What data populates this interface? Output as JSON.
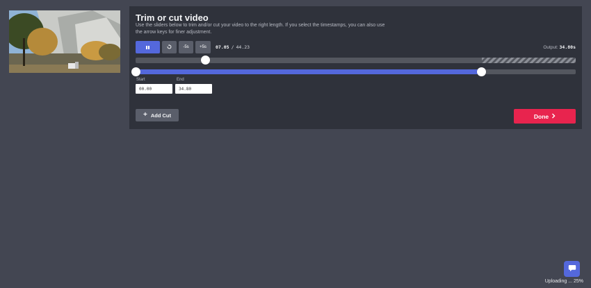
{
  "thumbnail": {
    "alt": "Yosemite valley video frame"
  },
  "editor": {
    "title": "Trim or cut video",
    "description": "Use the sliders below to trim and/or cut your video to the right length. If you select the timestamps, you can also use the arrow keys for finer adjustment.",
    "controls": {
      "pause_icon": "pause-icon",
      "restart_icon": "restart-icon",
      "back_label": "-5s",
      "forward_label": "+5s"
    },
    "current_time": "07.05",
    "separator": "/",
    "total_time": "44.23",
    "output_label": "Output:",
    "output_value": "34.80s",
    "playback_position_fraction": 0.16,
    "trim": {
      "start_label": "Start",
      "end_label": "End",
      "start_value": "00.00",
      "end_value": "34.80",
      "start_fraction": 0.0,
      "end_fraction": 0.787
    },
    "add_cut_label": "Add Cut",
    "done_label": "Done"
  },
  "status": {
    "uploading_text": "Uploading ... 25%"
  },
  "colors": {
    "accent": "#5468dc",
    "done": "#e8244e",
    "panel": "#2f323b",
    "background": "#434652"
  }
}
